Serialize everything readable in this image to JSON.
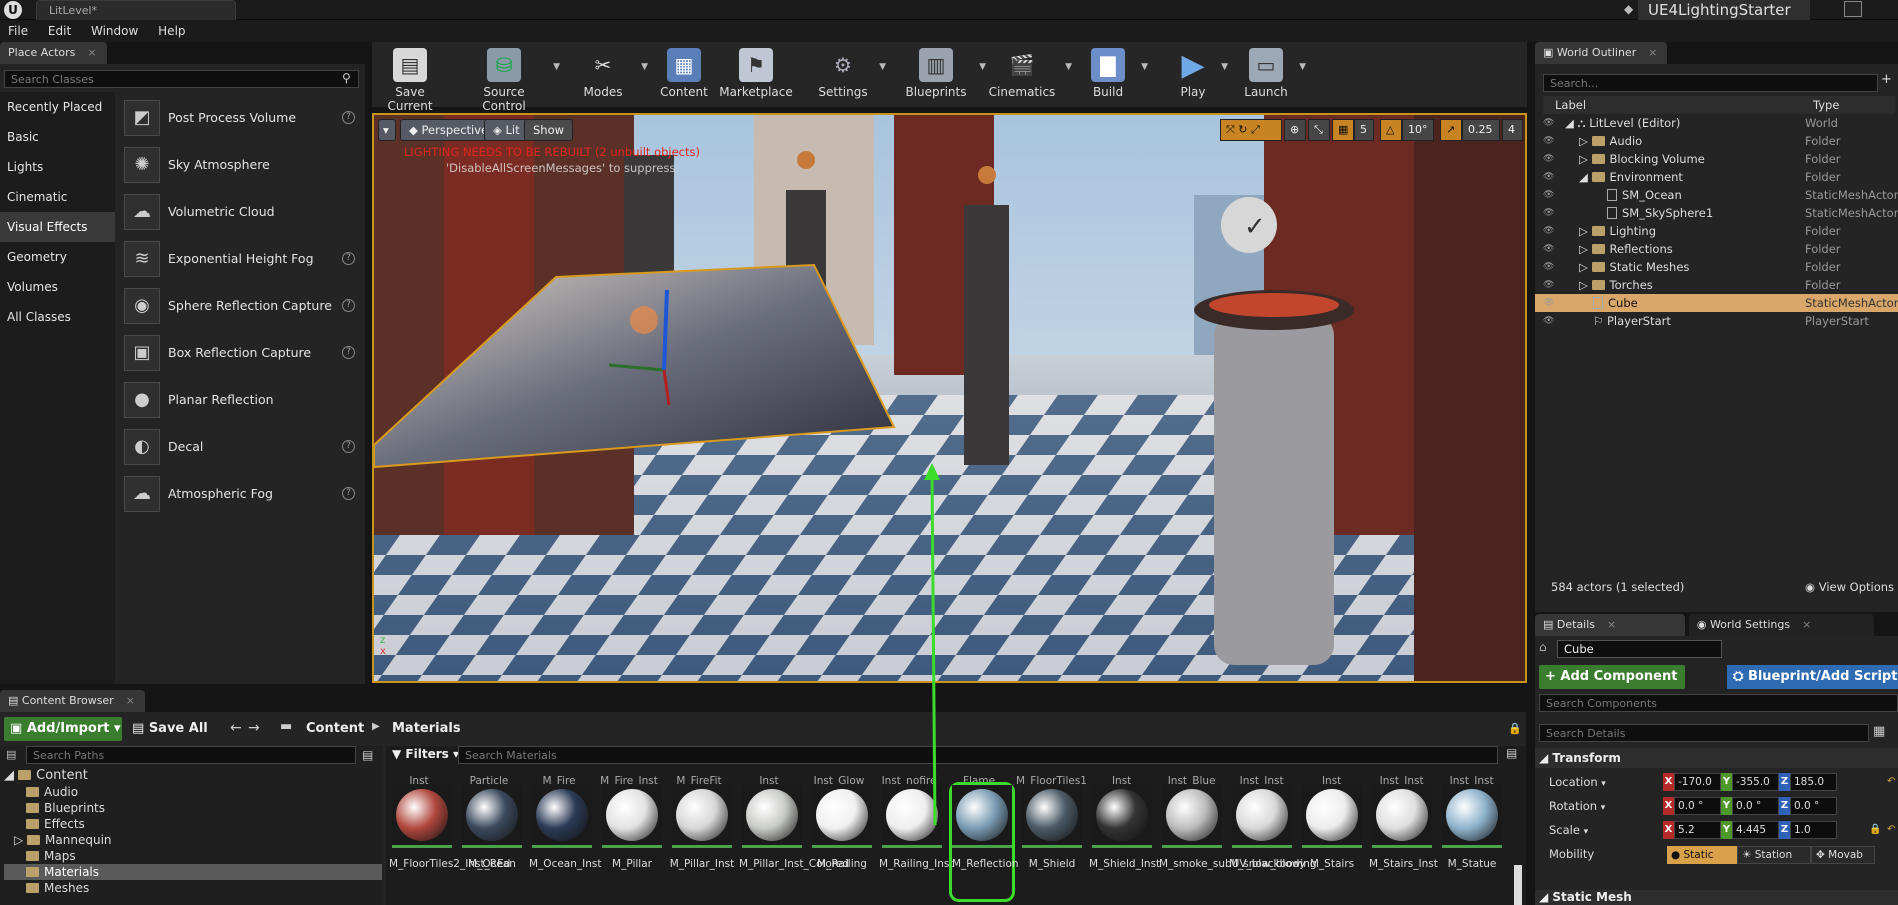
{
  "titlebar": {
    "doc_tab": "LitLevel*",
    "project": "UE4LightingStarter"
  },
  "menu": [
    "File",
    "Edit",
    "Window",
    "Help"
  ],
  "place_actors": {
    "tab": "Place Actors",
    "search_placeholder": "Search Classes",
    "categories": [
      "Recently Placed",
      "Basic",
      "Lights",
      "Cinematic",
      "Visual Effects",
      "Geometry",
      "Volumes",
      "All Classes"
    ],
    "selected_category": "Visual Effects",
    "items": [
      "Post Process Volume",
      "Sky Atmosphere",
      "Volumetric Cloud",
      "Exponential Height Fog",
      "Sphere Reflection Capture",
      "Box Reflection Capture",
      "Planar Reflection",
      "Decal",
      "Atmospheric Fog"
    ]
  },
  "toolbar": {
    "buttons": [
      "Save Current",
      "Source Control",
      "Modes",
      "Content",
      "Marketplace",
      "Settings",
      "Blueprints",
      "Cinematics",
      "Build",
      "Play",
      "Launch"
    ]
  },
  "viewport": {
    "perspective": "Perspective",
    "lit": "Lit",
    "show": "Show",
    "grid_snap": "5",
    "rot_snap": "10°",
    "scale_snap": "0.25",
    "cam_speed": "4",
    "warning": "LIGHTING NEEDS TO BE REBUILT (2 unbuilt objects)",
    "warning2": "'DisableAllScreenMessages' to suppress"
  },
  "outliner": {
    "tab": "World Outliner",
    "search_placeholder": "Search...",
    "col_label": "Label",
    "col_type": "Type",
    "rows": [
      {
        "label": "LitLevel (Editor)",
        "type": "World"
      },
      {
        "label": "Audio",
        "type": "Folder"
      },
      {
        "label": "Blocking Volume",
        "type": "Folder"
      },
      {
        "label": "Environment",
        "type": "Folder"
      },
      {
        "label": "SM_Ocean",
        "type": "StaticMeshActor"
      },
      {
        "label": "SM_SkySphere1",
        "type": "StaticMeshActor"
      },
      {
        "label": "Lighting",
        "type": "Folder"
      },
      {
        "label": "Reflections",
        "type": "Folder"
      },
      {
        "label": "Static Meshes",
        "type": "Folder"
      },
      {
        "label": "Torches",
        "type": "Folder"
      },
      {
        "label": "Cube",
        "type": "StaticMeshActor"
      },
      {
        "label": "PlayerStart",
        "type": "PlayerStart"
      }
    ],
    "status": "584 actors (1 selected)",
    "view_options": "View Options"
  },
  "details": {
    "tab_details": "Details",
    "tab_world": "World Settings",
    "name": "Cube",
    "add_component": "+ Add Component",
    "blueprint": "Blueprint/Add Script",
    "search_components": "Search Components",
    "search_details": "Search Details",
    "transform": "Transform",
    "location_label": "Location",
    "rotation_label": "Rotation",
    "scale_label": "Scale",
    "mobility_label": "Mobility",
    "location": [
      "-170.0",
      "-355.0",
      "185.0"
    ],
    "rotation": [
      "0.0 °",
      "0.0 °",
      "0.0 °"
    ],
    "scale": [
      "5.2",
      "4.445",
      "1.0"
    ],
    "mobility": [
      "Static",
      "Station",
      "Movab"
    ],
    "static_mesh": "Static Mesh"
  },
  "content_browser": {
    "tab": "Content Browser",
    "add_import": "Add/Import",
    "save_all": "Save All",
    "path": [
      "Content",
      "Materials"
    ],
    "search_paths": "Search Paths",
    "filters": "Filters",
    "search_materials": "Search Materials",
    "tree": [
      "Content",
      "Audio",
      "Blueprints",
      "Effects",
      "Mannequin",
      "Maps",
      "Materials",
      "Meshes"
    ],
    "prev_labels": [
      "Inst",
      "Particle",
      "M_Fire",
      "M_Fire_Inst",
      "M_FireFit",
      "Inst",
      "Inst_Glow",
      "Inst_nofire",
      "Flame",
      "M_FloorTiles1",
      "_Inst",
      "_Inst_Blue",
      "_Inst_Inst",
      "_Inst",
      "_Inst_Inst",
      "_Inst_Inst"
    ],
    "assets": [
      "M_FloorTiles2_Inst_REd",
      "M_Ocean",
      "M_Ocean_Inst",
      "M_Pillar",
      "M_Pillar_Inst",
      "M_Pillar_Inst_Colored",
      "M_Railing",
      "M_Railing_Inst",
      "M_Reflection",
      "M_Shield",
      "M_Shield_Inst",
      "M_smoke_subUV_blackbody",
      "M_snow_blowing",
      "M_Stairs",
      "M_Stairs_Inst",
      "M_Statue"
    ]
  }
}
